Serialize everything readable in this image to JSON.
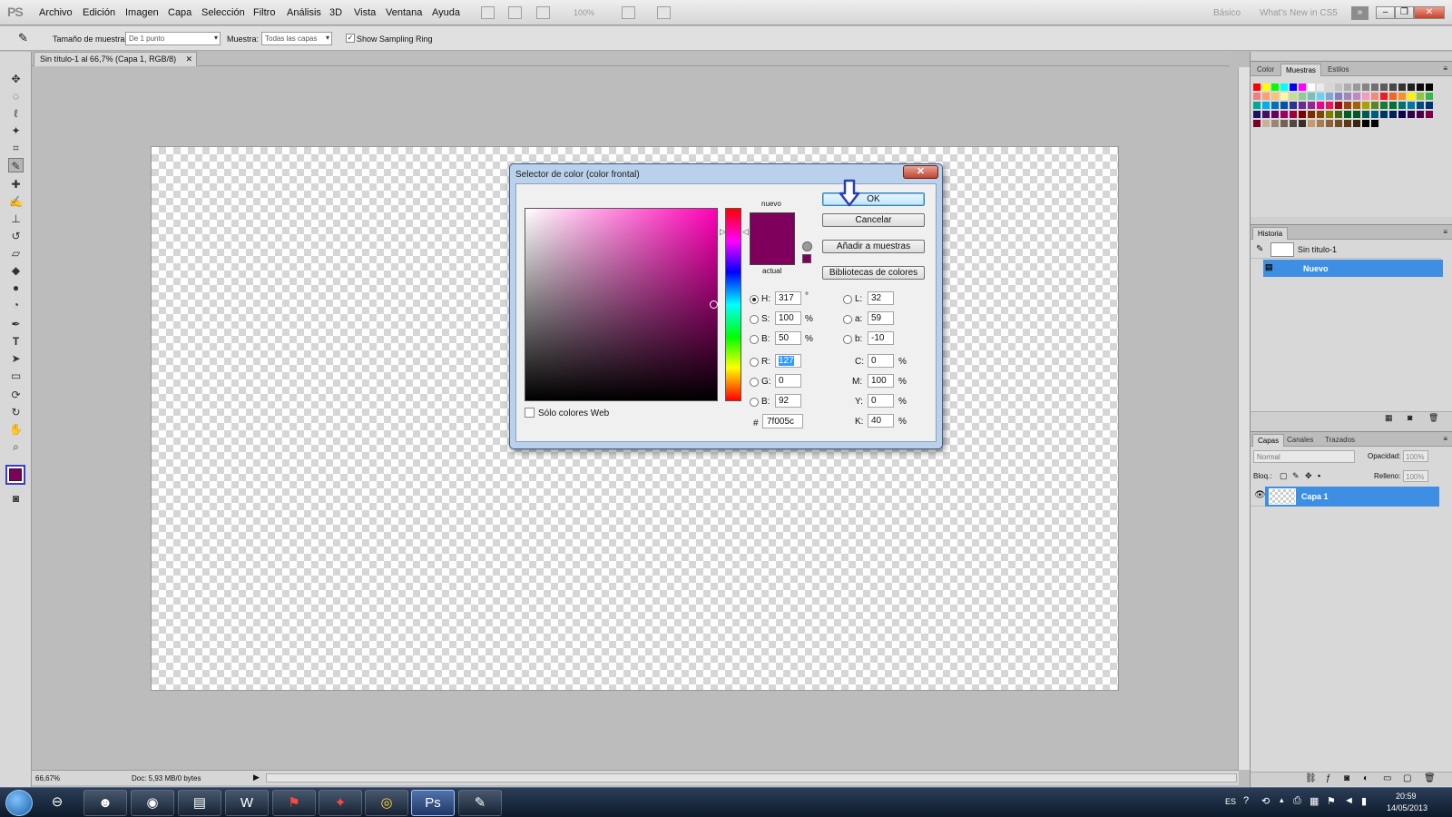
{
  "app": {
    "logo": "PS"
  },
  "menu": [
    "Archivo",
    "Edición",
    "Imagen",
    "Capa",
    "Selección",
    "Filtro",
    "Análisis",
    "3D",
    "Vista",
    "Ventana",
    "Ayuda"
  ],
  "menubar": {
    "zoom": "100%",
    "workspace_basic": "Básico",
    "workspace_new": "What's New in CS5"
  },
  "options": {
    "sample_size_label": "Tamaño de muestra:",
    "sample_size_value": "De 1 punto",
    "sample_label": "Muestra:",
    "sample_value": "Todas las capas",
    "sampling_ring_label": "Show Sampling Ring",
    "sampling_ring_checked": true
  },
  "document": {
    "tab_title": "Sin título-1 al 66,7% (Capa 1, RGB/8)"
  },
  "status": {
    "zoom": "66,67%",
    "doc_info": "Doc: 5,93 MB/0 bytes"
  },
  "panels": {
    "color_tabs": [
      "Color",
      "Muestras",
      "Estilos"
    ],
    "color_active_tab": "Muestras",
    "swatch_colors": [
      "#ff0000",
      "#ffff00",
      "#00ff00",
      "#00ffff",
      "#0000ff",
      "#ff00ff",
      "#ffffff",
      "#ebebeb",
      "#d6d6d6",
      "#c2c2c2",
      "#adadad",
      "#999999",
      "#858585",
      "#707070",
      "#5c5c5c",
      "#474747",
      "#333333",
      "#1f1f1f",
      "#0a0a0a",
      "#000000",
      "#f08080",
      "#f7a07a",
      "#fbc17a",
      "#fff799",
      "#c3df92",
      "#8fcc98",
      "#72c5b6",
      "#6ccff6",
      "#7ea7d8",
      "#8781bd",
      "#a186be",
      "#bd8cbf",
      "#f49ac1",
      "#f2897a",
      "#ed1c24",
      "#f26522",
      "#f7941d",
      "#fff200",
      "#8dc63f",
      "#39b54a",
      "#00a99d",
      "#00aeef",
      "#0072bc",
      "#0054a6",
      "#2e3192",
      "#662d91",
      "#92278f",
      "#ec008c",
      "#ed145b",
      "#9e0b0f",
      "#a0410d",
      "#a36209",
      "#aba000",
      "#598527",
      "#197b30",
      "#007236",
      "#00746b",
      "#0076a3",
      "#004a80",
      "#003471",
      "#1b1464",
      "#440e62",
      "#630460",
      "#9e005d",
      "#9e0039",
      "#790000",
      "#7b2e00",
      "#7d4900",
      "#827b00",
      "#406618",
      "#005e20",
      "#005826",
      "#005952",
      "#005b7f",
      "#003663",
      "#002157",
      "#0d004c",
      "#32004b",
      "#4b0049",
      "#7b0046",
      "#7a0026",
      "#c7b299",
      "#998675",
      "#736357",
      "#534741",
      "#37302a",
      "#c69c6d",
      "#a67c52",
      "#8c6239",
      "#754c24",
      "#603913",
      "#3c2415",
      "#000000",
      "#000000"
    ],
    "history_title": "Historia",
    "history_items": [
      "Sin título-1",
      "Nuevo"
    ],
    "layers_tabs": [
      "Capas",
      "Canales",
      "Trazados"
    ],
    "layers_active_tab": "Capas",
    "blend_mode": "Normal",
    "opacity_label": "Opacidad:",
    "opacity_value": "100%",
    "lock_label": "Bloq.:",
    "fill_label": "Relleno:",
    "fill_value": "100%",
    "layer_name": "Capa 1"
  },
  "dialog": {
    "title": "Selector de color (color frontal)",
    "close": "✕",
    "new_label": "nuevo",
    "current_label": "actual",
    "new_color": "#7f005c",
    "current_color": "#7f005c",
    "buttons": {
      "ok": "OK",
      "cancel": "Cancelar",
      "add": "Añadir a muestras",
      "libraries": "Bibliotecas de colores"
    },
    "hsb": {
      "h": "317",
      "s": "100",
      "b": "50"
    },
    "rgb": {
      "r": "127",
      "g": "0",
      "b": "92"
    },
    "lab": {
      "l": "32",
      "a": "59",
      "b": "-10"
    },
    "cmyk": {
      "c": "0",
      "m": "100",
      "y": "0",
      "k": "40"
    },
    "labels": {
      "h": "H:",
      "s": "S:",
      "bri": "B:",
      "r": "R:",
      "g": "G:",
      "blue": "B:",
      "l": "L:",
      "a": "a:",
      "lb": "b:",
      "c": "C:",
      "m": "M:",
      "y": "Y:",
      "k": "K:",
      "hash": "#"
    },
    "units": {
      "deg": "°",
      "pct": "%"
    },
    "hex": "7f005c",
    "web_only_label": "Sólo colores Web",
    "web_only_checked": false
  },
  "taskbar": {
    "lang": "ES",
    "time": "20:59",
    "date": "14/05/2013"
  }
}
